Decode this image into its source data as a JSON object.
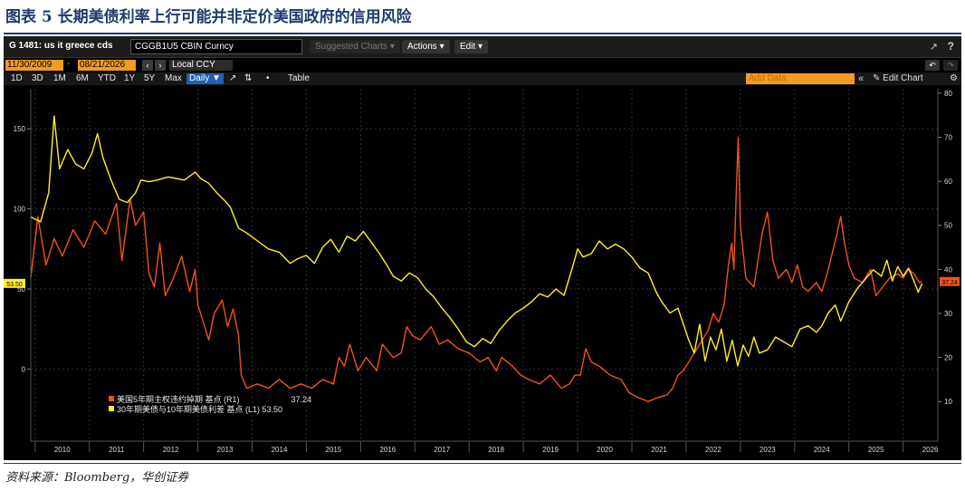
{
  "figure": {
    "title": "图表 5  长期美债利率上行可能并非定价美国政府的信用风险",
    "source": "资料来源：Bloomberg，华创证券"
  },
  "toolbar": {
    "command": "G 1481: us it greece cds",
    "ticker": "CGGB1U5 CBIN Curncy",
    "suggested": "Suggested Charts ▾",
    "actions": "Actions ▾",
    "edit": "Edit ▾",
    "export_icon": "export-icon",
    "help": "?"
  },
  "date_row": {
    "start": "11/30/2009",
    "end": "08/21/2026",
    "currency": "Local CCY"
  },
  "range_row": {
    "ranges": [
      "1D",
      "3D",
      "1M",
      "6M",
      "YTD",
      "1Y",
      "5Y",
      "Max"
    ],
    "frequency": "Daily ▼",
    "table": "Table",
    "add_data_placeholder": "Add Data",
    "edit_chart": "✎ Edit Chart"
  },
  "colors": {
    "background": "#000000",
    "cds_series": "#f0541e",
    "spread_series": "#ffef2a",
    "grid": "#2e2e2e",
    "axis_text": "#d8d8d8"
  },
  "chart_data": {
    "type": "line",
    "title": "",
    "x_ticks": [
      "2010",
      "2011",
      "2012",
      "2013",
      "2014",
      "2015",
      "2016",
      "2017",
      "2018",
      "2019",
      "2020",
      "2021",
      "2022",
      "2023",
      "2024",
      "2025",
      "2026"
    ],
    "xlim": [
      2009.92,
      2026.64
    ],
    "y_left": {
      "ticks": [
        0,
        50,
        100,
        150
      ],
      "lim": [
        -45,
        175
      ]
    },
    "y_right": {
      "ticks": [
        10,
        20,
        30,
        40,
        50,
        60,
        70,
        80
      ],
      "lim": [
        1,
        81
      ]
    },
    "last_values": {
      "left": "53.50",
      "right": "37.24"
    },
    "legend": [
      {
        "label": "美国5年期主权违约掉期 基点 (R1)",
        "value": "37.24",
        "color": "#f0541e"
      },
      {
        "label": "30年期美债与10年期美债利差 基点 (L1) 53.50",
        "value": "",
        "color": "#ffef2a"
      }
    ],
    "series": [
      {
        "name": "美国5年期主权违约掉期 基点",
        "axis": "right",
        "color": "#f0541e",
        "points": [
          [
            2009.92,
            38
          ],
          [
            2010.05,
            52
          ],
          [
            2010.2,
            41
          ],
          [
            2010.35,
            47
          ],
          [
            2010.5,
            43
          ],
          [
            2010.7,
            49
          ],
          [
            2010.9,
            45
          ],
          [
            2011.1,
            51
          ],
          [
            2011.3,
            48
          ],
          [
            2011.5,
            55
          ],
          [
            2011.6,
            42
          ],
          [
            2011.75,
            56
          ],
          [
            2011.85,
            50
          ],
          [
            2012.0,
            53
          ],
          [
            2012.1,
            39
          ],
          [
            2012.2,
            36
          ],
          [
            2012.3,
            46
          ],
          [
            2012.4,
            34
          ],
          [
            2012.55,
            38
          ],
          [
            2012.7,
            43
          ],
          [
            2012.85,
            35
          ],
          [
            2012.95,
            40
          ],
          [
            2013.0,
            32
          ],
          [
            2013.1,
            28
          ],
          [
            2013.2,
            24
          ],
          [
            2013.3,
            30
          ],
          [
            2013.45,
            33
          ],
          [
            2013.55,
            27
          ],
          [
            2013.65,
            31
          ],
          [
            2013.75,
            25
          ],
          [
            2013.8,
            16
          ],
          [
            2013.9,
            13
          ],
          [
            2014.1,
            14
          ],
          [
            2014.3,
            13
          ],
          [
            2014.5,
            15
          ],
          [
            2014.7,
            13
          ],
          [
            2014.9,
            14
          ],
          [
            2015.1,
            13
          ],
          [
            2015.3,
            15
          ],
          [
            2015.5,
            14
          ],
          [
            2015.6,
            20
          ],
          [
            2015.7,
            18
          ],
          [
            2015.8,
            23
          ],
          [
            2015.95,
            17
          ],
          [
            2016.1,
            20
          ],
          [
            2016.3,
            17
          ],
          [
            2016.4,
            23
          ],
          [
            2016.6,
            20
          ],
          [
            2016.75,
            21
          ],
          [
            2016.85,
            27
          ],
          [
            2016.95,
            25
          ],
          [
            2017.1,
            24
          ],
          [
            2017.3,
            27
          ],
          [
            2017.45,
            23
          ],
          [
            2017.6,
            24
          ],
          [
            2017.8,
            22
          ],
          [
            2018.0,
            21
          ],
          [
            2018.2,
            19
          ],
          [
            2018.35,
            20
          ],
          [
            2018.5,
            17
          ],
          [
            2018.6,
            20
          ],
          [
            2018.8,
            18
          ],
          [
            2018.95,
            16
          ],
          [
            2019.1,
            15
          ],
          [
            2019.3,
            14
          ],
          [
            2019.5,
            16
          ],
          [
            2019.7,
            13
          ],
          [
            2019.85,
            14
          ],
          [
            2019.95,
            16
          ],
          [
            2020.05,
            16
          ],
          [
            2020.15,
            22
          ],
          [
            2020.25,
            19
          ],
          [
            2020.4,
            18
          ],
          [
            2020.6,
            16
          ],
          [
            2020.8,
            15
          ],
          [
            2020.95,
            12
          ],
          [
            2021.1,
            11
          ],
          [
            2021.3,
            10
          ],
          [
            2021.5,
            11
          ],
          [
            2021.65,
            11.5
          ],
          [
            2021.75,
            13
          ],
          [
            2021.85,
            16
          ],
          [
            2021.95,
            17
          ],
          [
            2022.1,
            20
          ],
          [
            2022.25,
            23
          ],
          [
            2022.4,
            26
          ],
          [
            2022.5,
            30
          ],
          [
            2022.6,
            28
          ],
          [
            2022.7,
            32
          ],
          [
            2022.78,
            41
          ],
          [
            2022.84,
            46
          ],
          [
            2022.88,
            40
          ],
          [
            2022.92,
            56
          ],
          [
            2022.96,
            70
          ],
          [
            2023.0,
            50
          ],
          [
            2023.1,
            38
          ],
          [
            2023.25,
            36
          ],
          [
            2023.4,
            48
          ],
          [
            2023.5,
            53
          ],
          [
            2023.6,
            42
          ],
          [
            2023.7,
            38
          ],
          [
            2023.85,
            40
          ],
          [
            2023.95,
            37
          ],
          [
            2024.05,
            41
          ],
          [
            2024.15,
            36
          ],
          [
            2024.25,
            35
          ],
          [
            2024.4,
            37
          ],
          [
            2024.5,
            35
          ],
          [
            2024.6,
            39
          ],
          [
            2024.7,
            44
          ],
          [
            2024.78,
            48
          ],
          [
            2024.85,
            52
          ],
          [
            2024.92,
            46
          ],
          [
            2025.0,
            41
          ],
          [
            2025.1,
            38
          ],
          [
            2025.25,
            37
          ],
          [
            2025.4,
            40
          ],
          [
            2025.5,
            34
          ],
          [
            2025.62,
            36
          ],
          [
            2025.75,
            38
          ],
          [
            2025.9,
            39
          ],
          [
            2026.0,
            38
          ],
          [
            2026.1,
            40
          ],
          [
            2026.2,
            39
          ],
          [
            2026.3,
            37
          ],
          [
            2026.35,
            37.24
          ]
        ]
      },
      {
        "name": "30年期美债与10年期美债利差 基点",
        "axis": "left",
        "color": "#ffef2a",
        "points": [
          [
            2009.92,
            95
          ],
          [
            2010.1,
            92
          ],
          [
            2010.25,
            110
          ],
          [
            2010.35,
            158
          ],
          [
            2010.45,
            125
          ],
          [
            2010.6,
            137
          ],
          [
            2010.75,
            128
          ],
          [
            2010.9,
            125
          ],
          [
            2011.05,
            135
          ],
          [
            2011.15,
            147
          ],
          [
            2011.25,
            132
          ],
          [
            2011.4,
            118
          ],
          [
            2011.55,
            106
          ],
          [
            2011.7,
            104
          ],
          [
            2011.85,
            110
          ],
          [
            2011.95,
            118
          ],
          [
            2012.1,
            117
          ],
          [
            2012.25,
            118
          ],
          [
            2012.45,
            120
          ],
          [
            2012.6,
            119
          ],
          [
            2012.75,
            118
          ],
          [
            2012.95,
            123
          ],
          [
            2013.05,
            119
          ],
          [
            2013.2,
            116
          ],
          [
            2013.35,
            110
          ],
          [
            2013.5,
            105
          ],
          [
            2013.6,
            101
          ],
          [
            2013.75,
            88
          ],
          [
            2013.9,
            85
          ],
          [
            2014.1,
            80
          ],
          [
            2014.3,
            75
          ],
          [
            2014.5,
            73
          ],
          [
            2014.7,
            66
          ],
          [
            2014.85,
            69
          ],
          [
            2015.0,
            71
          ],
          [
            2015.15,
            66
          ],
          [
            2015.3,
            76
          ],
          [
            2015.45,
            81
          ],
          [
            2015.6,
            73
          ],
          [
            2015.75,
            83
          ],
          [
            2015.9,
            80
          ],
          [
            2016.05,
            86
          ],
          [
            2016.2,
            79
          ],
          [
            2016.35,
            72
          ],
          [
            2016.5,
            64
          ],
          [
            2016.6,
            58
          ],
          [
            2016.75,
            55
          ],
          [
            2016.9,
            60
          ],
          [
            2017.05,
            57
          ],
          [
            2017.2,
            50
          ],
          [
            2017.35,
            45
          ],
          [
            2017.5,
            38
          ],
          [
            2017.65,
            32
          ],
          [
            2017.8,
            25
          ],
          [
            2017.95,
            17
          ],
          [
            2018.1,
            14
          ],
          [
            2018.25,
            19
          ],
          [
            2018.4,
            16
          ],
          [
            2018.55,
            24
          ],
          [
            2018.7,
            30
          ],
          [
            2018.85,
            35
          ],
          [
            2019.0,
            38
          ],
          [
            2019.15,
            42
          ],
          [
            2019.3,
            47
          ],
          [
            2019.45,
            45
          ],
          [
            2019.6,
            50
          ],
          [
            2019.75,
            46
          ],
          [
            2019.9,
            63
          ],
          [
            2020.0,
            75
          ],
          [
            2020.1,
            70
          ],
          [
            2020.25,
            72
          ],
          [
            2020.4,
            80
          ],
          [
            2020.55,
            75
          ],
          [
            2020.7,
            78
          ],
          [
            2020.85,
            75
          ],
          [
            2021.0,
            70
          ],
          [
            2021.15,
            63
          ],
          [
            2021.3,
            60
          ],
          [
            2021.45,
            48
          ],
          [
            2021.55,
            42
          ],
          [
            2021.7,
            35
          ],
          [
            2021.85,
            38
          ],
          [
            2021.95,
            28
          ],
          [
            2022.05,
            18
          ],
          [
            2022.15,
            10
          ],
          [
            2022.25,
            28
          ],
          [
            2022.35,
            5
          ],
          [
            2022.45,
            20
          ],
          [
            2022.55,
            12
          ],
          [
            2022.65,
            25
          ],
          [
            2022.75,
            5
          ],
          [
            2022.85,
            18
          ],
          [
            2022.95,
            2
          ],
          [
            2023.05,
            15
          ],
          [
            2023.15,
            8
          ],
          [
            2023.25,
            20
          ],
          [
            2023.35,
            10
          ],
          [
            2023.5,
            12
          ],
          [
            2023.65,
            20
          ],
          [
            2023.8,
            17
          ],
          [
            2023.95,
            14
          ],
          [
            2024.1,
            25
          ],
          [
            2024.25,
            27
          ],
          [
            2024.4,
            23
          ],
          [
            2024.5,
            27
          ],
          [
            2024.62,
            35
          ],
          [
            2024.75,
            40
          ],
          [
            2024.85,
            30
          ],
          [
            2025.0,
            42
          ],
          [
            2025.15,
            50
          ],
          [
            2025.3,
            56
          ],
          [
            2025.45,
            62
          ],
          [
            2025.6,
            58
          ],
          [
            2025.7,
            68
          ],
          [
            2025.8,
            55
          ],
          [
            2025.9,
            64
          ],
          [
            2026.0,
            58
          ],
          [
            2026.1,
            63
          ],
          [
            2026.2,
            55
          ],
          [
            2026.28,
            48
          ],
          [
            2026.35,
            53.5
          ]
        ]
      }
    ]
  }
}
